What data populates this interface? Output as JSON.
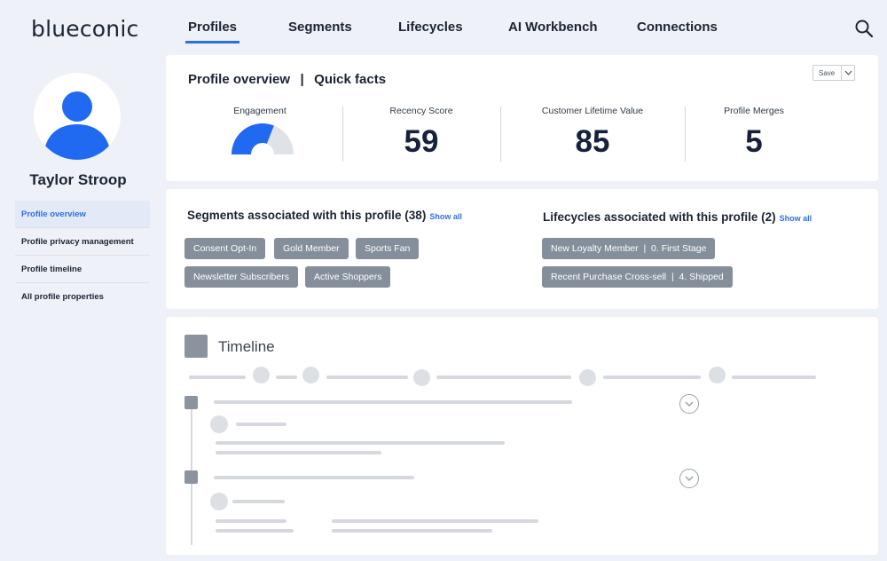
{
  "app": {
    "logo": "blueconic"
  },
  "nav": {
    "tabs": [
      "Profiles",
      "Segments",
      "Lifecycles",
      "AI Workbench",
      "Connections"
    ],
    "active": "Profiles"
  },
  "profile": {
    "name": "Taylor Stroop"
  },
  "sidebar": {
    "items": [
      {
        "label": "Profile overview",
        "active": true
      },
      {
        "label": "Profile privacy management"
      },
      {
        "label": "Profile timeline"
      },
      {
        "label": "All profile properties"
      }
    ]
  },
  "overview": {
    "title": "Profile overview",
    "subtitle": "Quick facts",
    "save_label": "Save",
    "stats": {
      "engagement_label": "Engagement",
      "engagement_level": 0.62,
      "recency_label": "Recency Score",
      "recency_value": "59",
      "clv_label": "Customer Lifetime Value",
      "clv_value": "85",
      "merges_label": "Profile Merges",
      "merges_value": "5"
    }
  },
  "segments": {
    "title": "Segments associated with this profile (38)",
    "show_all": "Show all",
    "tags": [
      "Consent Opt-In",
      "Gold Member",
      "Sports Fan",
      "Newsletter Subscribers",
      "Active Shoppers"
    ]
  },
  "lifecycles": {
    "title": "Lifecycles associated with this profile (2)",
    "show_all": "Show all",
    "tags": [
      "New Loyalty Member  |  0. First Stage",
      "Recent Purchase Cross-sell  |  4. Shipped"
    ]
  },
  "timeline": {
    "title": "Timeline"
  },
  "colors": {
    "accent": "#2f6fe4",
    "avatar": "#1f6af0",
    "tag": "#858f9c",
    "gauge_empty": "#dfe2e7"
  }
}
